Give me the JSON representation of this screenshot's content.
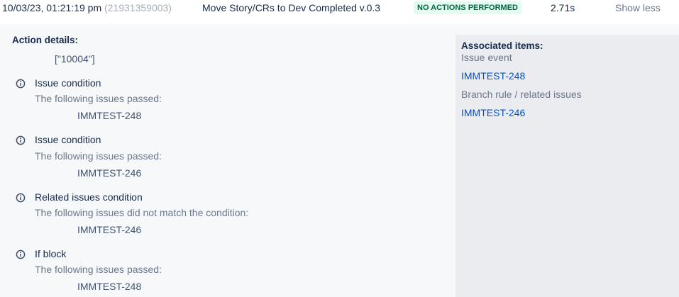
{
  "header": {
    "timestamp": "10/03/23, 01:21:19 pm",
    "run_id": "(21931359003)",
    "rule_name": "Move Story/CRs to Dev Completed v.0.3",
    "status": "NO ACTIONS PERFORMED",
    "duration": "2.71s",
    "toggle_label": "Show less"
  },
  "details": {
    "title": "Action details:",
    "value": "[\"10004\"]",
    "conditions": [
      {
        "title": "Issue condition",
        "desc": "The following issues passed:",
        "issue": "IMMTEST-248"
      },
      {
        "title": "Issue condition",
        "desc": "The following issues passed:",
        "issue": "IMMTEST-246"
      },
      {
        "title": "Related issues condition",
        "desc": "The following issues did not match the condition:",
        "issue": "IMMTEST-246"
      },
      {
        "title": "If block",
        "desc": "The following issues passed:",
        "issue": "IMMTEST-248"
      }
    ]
  },
  "associated": {
    "title": "Associated items:",
    "groups": [
      {
        "label": "Issue event",
        "link": "IMMTEST-248"
      },
      {
        "label": "Branch rule / related issues",
        "link": "IMMTEST-246"
      }
    ]
  },
  "colors": {
    "badge_bg": "#e3fcef",
    "badge_text": "#006644",
    "link": "#0052cc",
    "muted": "#6b778c"
  }
}
